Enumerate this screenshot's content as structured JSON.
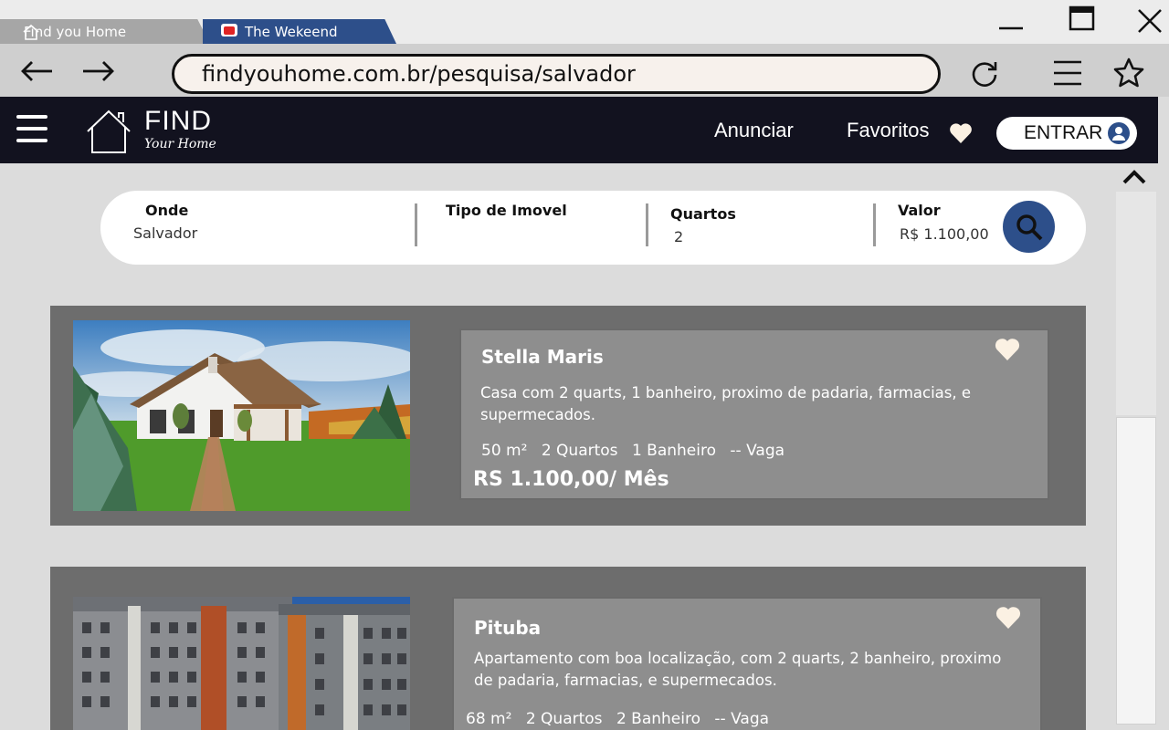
{
  "browser": {
    "tabs": [
      {
        "label": "Find you Home",
        "icon": "home-icon"
      },
      {
        "label": "The Wekeend",
        "icon": "youtube-icon"
      }
    ],
    "url": "findyouhome.com.br/pesquisa/salvador",
    "window_controls": [
      "minimize-icon",
      "maximize-icon",
      "close-icon"
    ]
  },
  "header": {
    "logo_main": "FIND",
    "logo_sub": "Your Home",
    "nav": {
      "anunciar": "Anunciar",
      "favoritos": "Favoritos",
      "entrar": "ENTRAR"
    }
  },
  "search": {
    "fields": [
      {
        "label": "Onde",
        "value": "Salvador"
      },
      {
        "label": "Tipo de Imovel",
        "value": ""
      },
      {
        "label": "Quartos",
        "value": "2"
      },
      {
        "label": "Valor",
        "value": "R$ 1.100,00"
      }
    ]
  },
  "listings": [
    {
      "title": "Stella Maris",
      "description": "Casa com 2 quarts, 1 banheiro, proximo de padaria, farmacias, e supermecados.",
      "features": [
        "50 m²",
        "2 Quartos",
        "1 Banheiro",
        "-- Vaga"
      ],
      "price": "RS 1.100,00/ Mês"
    },
    {
      "title": "Pituba",
      "description": "Apartamento com boa localização, com 2 quarts, 2 banheiro, proximo de padaria, farmacias, e supermecados.",
      "features": [
        "68 m²",
        "2 Quartos",
        "2 Banheiro",
        "-- Vaga"
      ],
      "price": ""
    }
  ],
  "colors": {
    "header_bg": "#12121f",
    "accent_blue": "#2d4f8a",
    "card_bg": "#6d6d6d",
    "info_bg": "#8e8e8e",
    "heart": "#fbf1e3"
  }
}
